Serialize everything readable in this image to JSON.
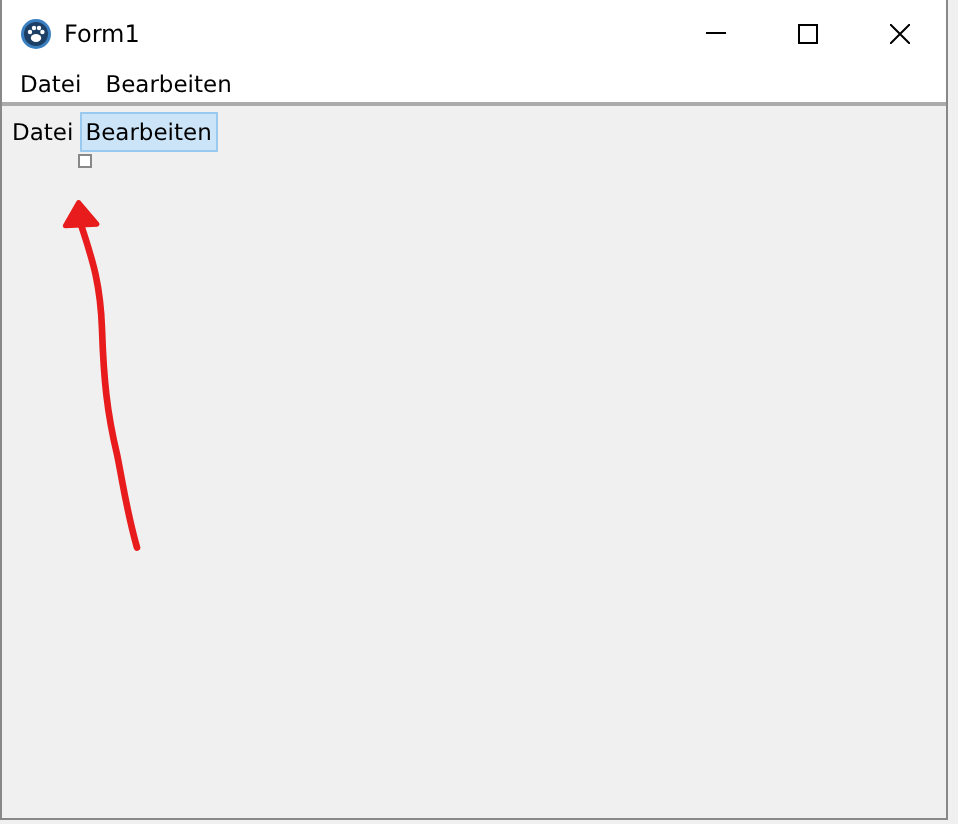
{
  "window": {
    "title": "Form1"
  },
  "menu_bar": {
    "items": [
      {
        "label": "Datei"
      },
      {
        "label": "Bearbeiten"
      }
    ]
  },
  "designer_menu": {
    "items": [
      {
        "label": "Datei",
        "selected": false
      },
      {
        "label": "Bearbeiten",
        "selected": true
      }
    ]
  }
}
